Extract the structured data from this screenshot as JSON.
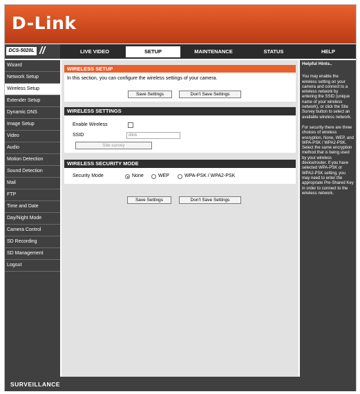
{
  "brand": {
    "logo": "D-Link",
    "model": "DCS-5020L",
    "footer": "SURVEILLANCE"
  },
  "nav": {
    "tabs": [
      {
        "label": "LIVE VIDEO"
      },
      {
        "label": "SETUP"
      },
      {
        "label": "MAINTENANCE"
      },
      {
        "label": "STATUS"
      },
      {
        "label": "HELP"
      }
    ],
    "active_tab": "SETUP"
  },
  "sidebar": {
    "items": [
      "Wizard",
      "Network Setup",
      "Wireless Setup",
      "Extender Setup",
      "Dynamic DNS",
      "Image Setup",
      "Video",
      "Audio",
      "Motion Detection",
      "Sound Detection",
      "Mail",
      "FTP",
      "Time and Date",
      "Day/Night Mode",
      "Camera Control",
      "SD Recording",
      "SD Management",
      "Logout"
    ],
    "active": "Wireless Setup"
  },
  "wireless_setup": {
    "title": "WIRELESS SETUP",
    "description": "In this section, you can configure the wireless settings of your camera.",
    "save_label": "Save Settings",
    "dont_save_label": "Don't Save Settings"
  },
  "wireless_settings": {
    "title": "WIRELESS SETTINGS",
    "enable_label": "Enable Wireless",
    "enable_checked": false,
    "ssid_label": "SSID",
    "ssid_value": "dlink",
    "site_survey_label": "Site survey"
  },
  "security": {
    "title": "WIRELESS SECURITY MODE",
    "mode_label": "Security Mode",
    "options": [
      "None",
      "WEP",
      "WPA-PSK / WPA2-PSK"
    ],
    "selected": "None"
  },
  "bottom_buttons": {
    "save_label": "Save Settings",
    "dont_save_label": "Don't Save Settings"
  },
  "help": {
    "title": "Helpful Hints..",
    "para1": "You may enable the wireless setting on your camera and connect to a wireless network by entering the SSID (unique name of your wireless network), or click the Site Survey button to select an available wireless network.",
    "para2": "For security there are three choices of wireless encryption, None, WEP, and WPA-PSK / WPA2-PSK. Select the same encryption method that is being used by your wireless device/router. If you have selected WPA-PSK or WPA2-PSK setting, you may need to enter the appropriate Pre-Shared Key in order to connect to the wireless network."
  },
  "colors": {
    "accent": "#e9602c",
    "dark": "#404040",
    "panel": "#e2e2e2"
  }
}
